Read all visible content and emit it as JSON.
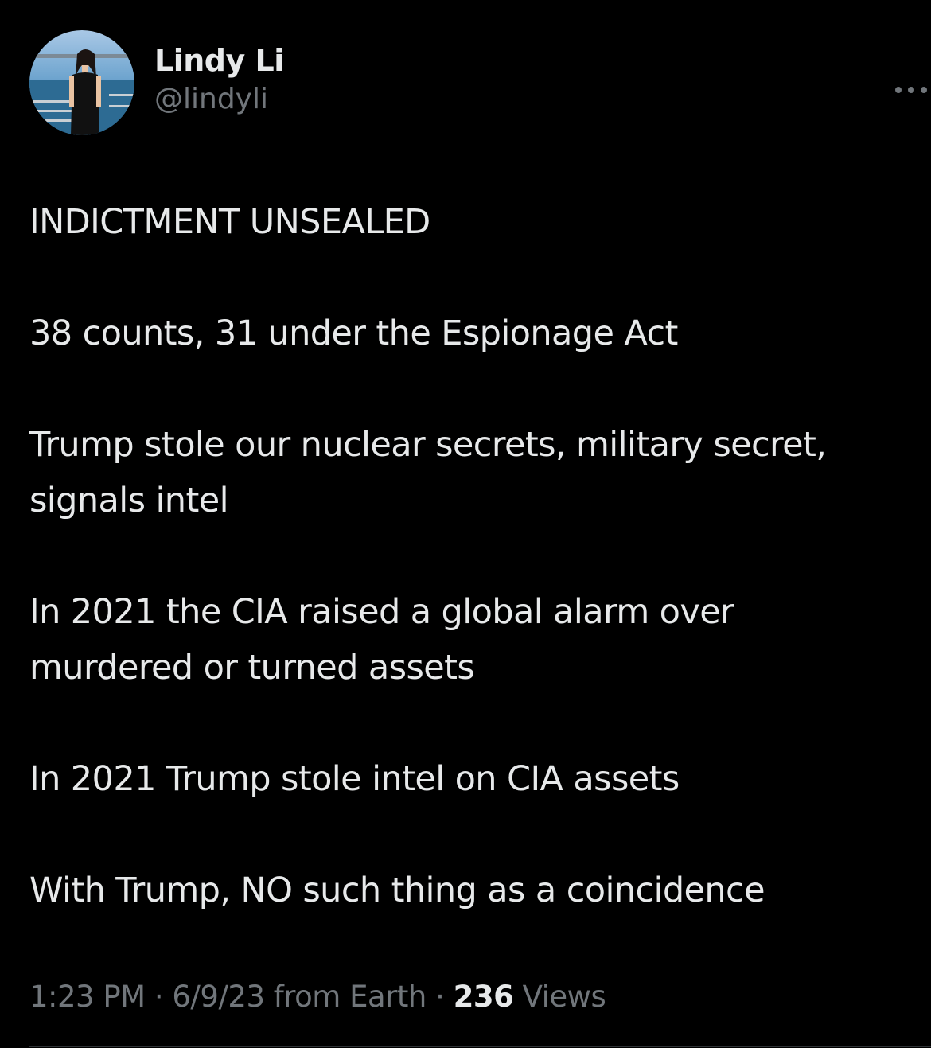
{
  "author": {
    "display_name": "Lindy Li",
    "handle": "@lindyli",
    "avatar_icon": "profile-photo"
  },
  "more_icon": "more-horizontal-icon",
  "tweet": {
    "paragraphs": [
      "INDICTMENT UNSEALED",
      "38 counts, 31 under the Espionage Act",
      "Trump stole our nuclear secrets, military secret, signals intel",
      "In 2021 the CIA raised a global alarm over murdered or turned assets",
      "In 2021 Trump stole intel on CIA assets",
      "With Trump, NO such thing as a coincidence"
    ]
  },
  "meta": {
    "time": "1:23 PM",
    "sep1": " · ",
    "date": "6/9/23",
    "source": " from Earth",
    "sep2": " · ",
    "views_count": "236",
    "views_label": " Views"
  },
  "colors": {
    "background": "#000000",
    "primary_text": "#e7e9ea",
    "secondary_text": "#71767b",
    "divider": "#2f3336"
  }
}
